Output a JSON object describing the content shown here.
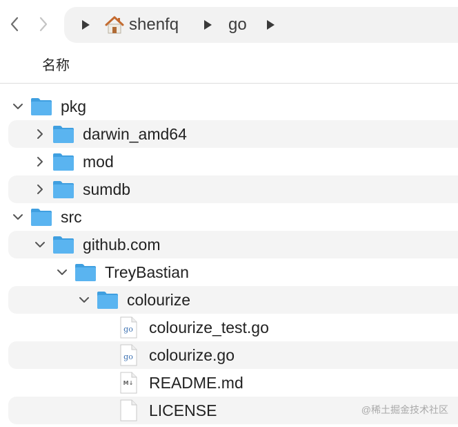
{
  "toolbar": {
    "back_icon": "chevron-left-icon",
    "forward_icon": "chevron-right-icon",
    "path": [
      "shenfq",
      "go"
    ],
    "home_icon": "home-icon"
  },
  "header": {
    "name_column": "名称"
  },
  "colors": {
    "folder": "#5ab4f0",
    "folder_dark": "#3f9fe0",
    "stripe": "#f4f4f4",
    "text": "#222222"
  },
  "tree": [
    {
      "label": "pkg",
      "kind": "folder",
      "expanded": true,
      "depth": 0
    },
    {
      "label": "darwin_amd64",
      "kind": "folder",
      "expanded": false,
      "depth": 1
    },
    {
      "label": "mod",
      "kind": "folder",
      "expanded": false,
      "depth": 1
    },
    {
      "label": "sumdb",
      "kind": "folder",
      "expanded": false,
      "depth": 1
    },
    {
      "label": "src",
      "kind": "folder",
      "expanded": true,
      "depth": 0
    },
    {
      "label": "github.com",
      "kind": "folder",
      "expanded": true,
      "depth": 1
    },
    {
      "label": "TreyBastian",
      "kind": "folder",
      "expanded": true,
      "depth": 2
    },
    {
      "label": "colourize",
      "kind": "folder",
      "expanded": true,
      "depth": 3
    },
    {
      "label": "colourize_test.go",
      "kind": "go-file",
      "depth": 4
    },
    {
      "label": "colourize.go",
      "kind": "go-file",
      "depth": 4
    },
    {
      "label": "README.md",
      "kind": "markdown-file",
      "depth": 4
    },
    {
      "label": "LICENSE",
      "kind": "text-file",
      "depth": 4
    }
  ],
  "watermark": "@稀土掘金技术社区"
}
